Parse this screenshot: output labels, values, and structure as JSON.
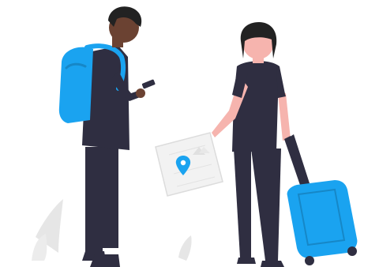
{
  "illustration": {
    "subject": "travelers",
    "colors": {
      "ink": "#2f2e41",
      "accent": "#1aa3f0",
      "skin_dark": "#6b4232",
      "skin_light": "#f6b4ae",
      "hair": "#222222",
      "paper": "#f2f2f2",
      "plant": "#e6e6e6"
    },
    "icons": [
      "backpack-icon",
      "phone-icon",
      "map-icon",
      "location-pin-icon",
      "suitcase-icon"
    ]
  }
}
